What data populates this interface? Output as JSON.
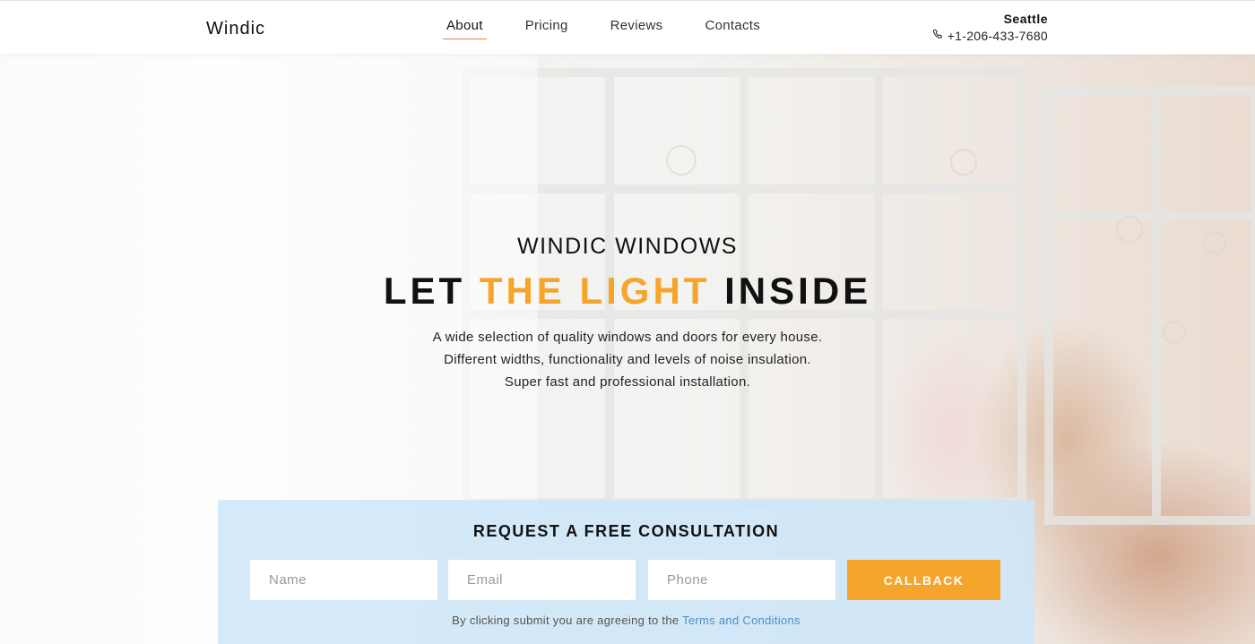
{
  "header": {
    "logo": "Windic",
    "nav": [
      {
        "label": "About",
        "active": true
      },
      {
        "label": "Pricing",
        "active": false
      },
      {
        "label": "Reviews",
        "active": false
      },
      {
        "label": "Contacts",
        "active": false
      }
    ],
    "city": "Seattle",
    "phone_icon": "phone-icon",
    "phone": "+1-206-433-7680"
  },
  "hero": {
    "subtitle": "WINDIC WINDOWS",
    "title_before": "LET ",
    "title_accent": "THE LIGHT",
    "title_after": " INSIDE",
    "description": [
      "A wide selection of quality windows and doors for every house.",
      "Different widths, functionality and levels of noise insulation.",
      "Super fast and professional installation."
    ]
  },
  "form": {
    "title": "REQUEST A FREE CONSULTATION",
    "name_placeholder": "Name",
    "email_placeholder": "Email",
    "phone_placeholder": "Phone",
    "submit_label": "CALLBACK",
    "terms_prefix": "By clicking submit you are agreeing to the ",
    "terms_link": "Terms and Conditions"
  },
  "colors": {
    "accent": "#f5a52b",
    "nav_underline": "#e8833a",
    "link": "#4a8fc7",
    "panel": "#cce5f8"
  }
}
